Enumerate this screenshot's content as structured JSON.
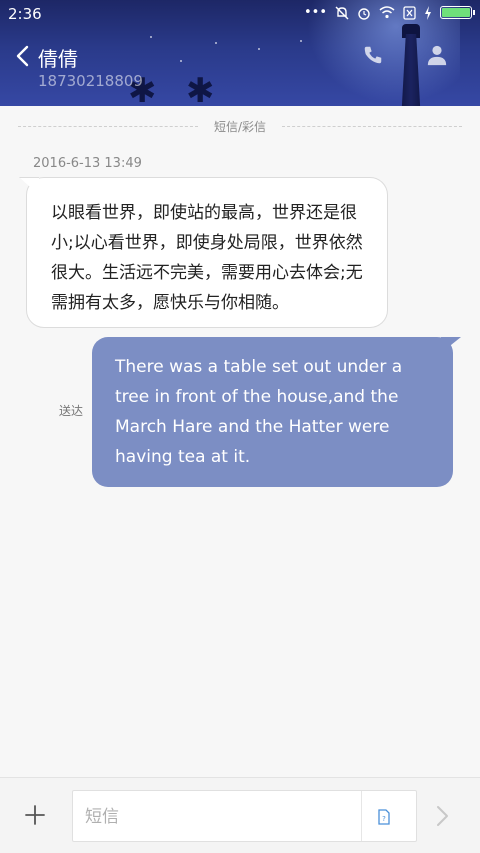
{
  "status_bar": {
    "time": "2:36",
    "dots": "•••"
  },
  "header": {
    "contact_name": "倩倩",
    "contact_number": "18730218809"
  },
  "thread": {
    "section_label": "短信/彩信",
    "timestamp": "2016-6-13 13:49",
    "incoming_message": "以眼看世界，即使站的最高，世界还是很小;以心看世界，即使身处局限，世界依然很大。生活远不完美，需要用心去体会;无需拥有太多，愿快乐与你相随。",
    "outgoing_message": "There was a table set out under a tree in front of the house,and the March Hare and the Hatter were having tea at it.",
    "delivery_status": "送达"
  },
  "composer": {
    "placeholder": "短信",
    "value": ""
  },
  "colors": {
    "header_bg": "#2a3a8a",
    "outgoing_bubble": "#7c8ec4",
    "battery": "#6fe07a"
  },
  "icons": [
    "back-arrow-icon",
    "phone-icon",
    "person-icon",
    "plus-icon",
    "sim-card-icon",
    "send-arrow-icon",
    "mute-bell-icon",
    "alarm-icon",
    "wifi-icon",
    "no-sim-icon",
    "charging-icon",
    "battery-icon"
  ]
}
